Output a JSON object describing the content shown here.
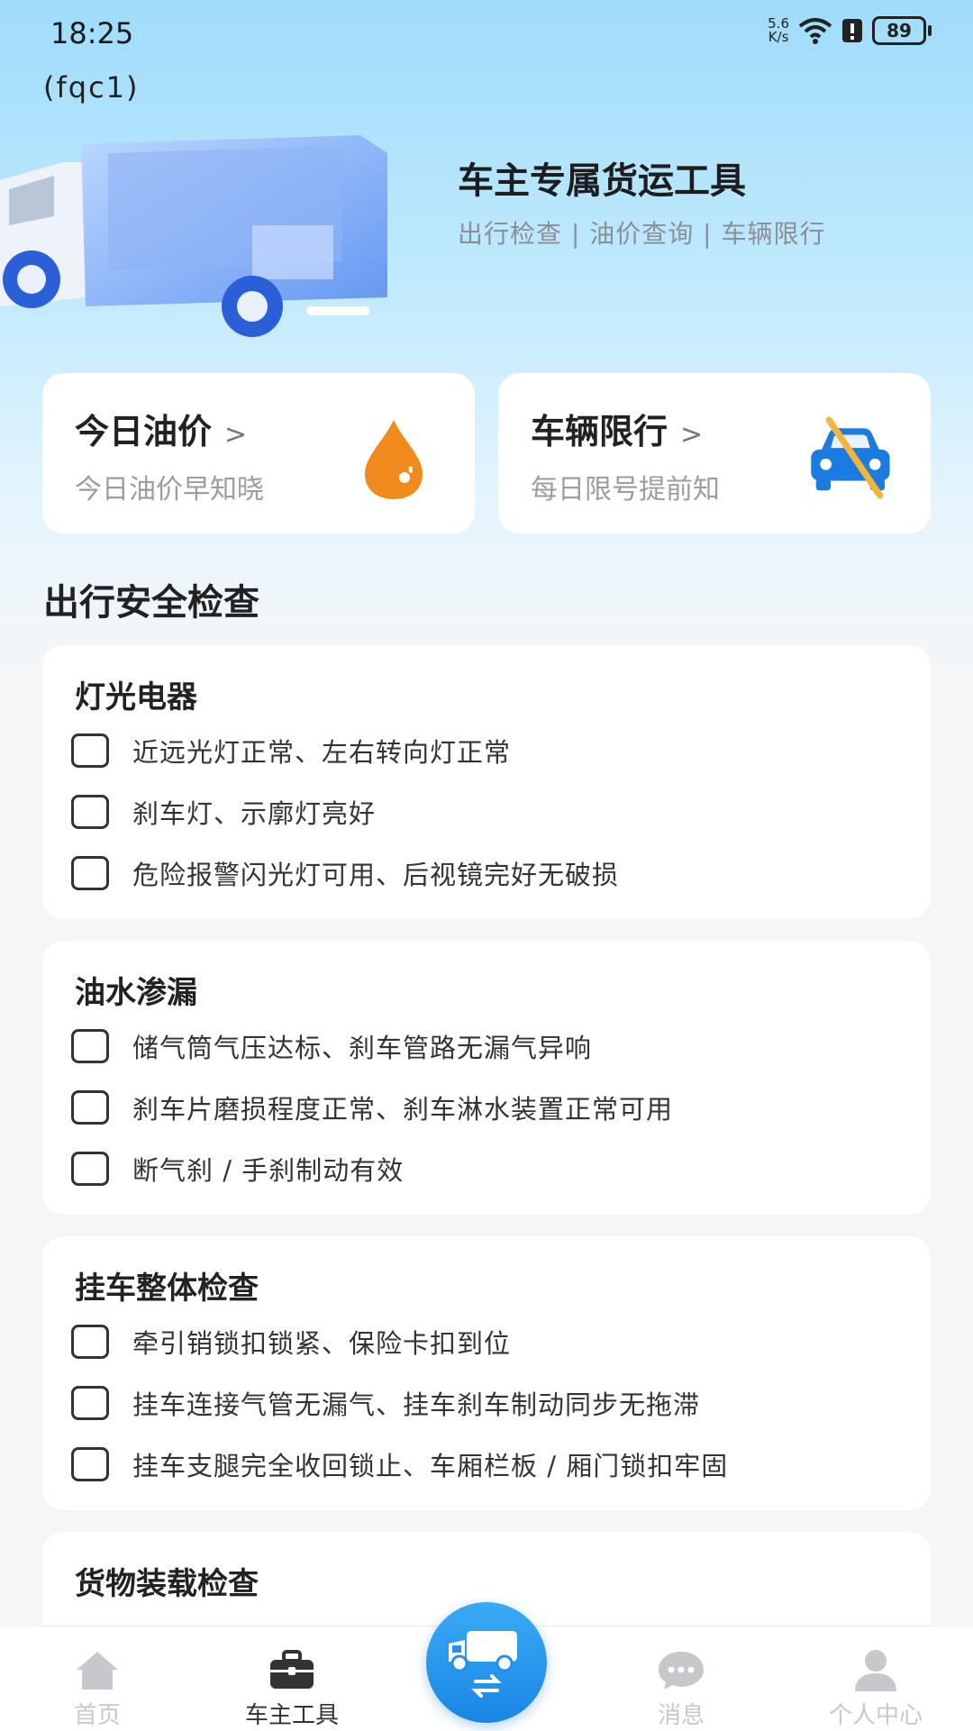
{
  "status_bar": {
    "time": "18:25",
    "speed_value": "5.6",
    "speed_unit": "K/s",
    "battery": "89"
  },
  "app_label": "(fqc1)",
  "hero": {
    "title": "车主专属货运工具",
    "subtitle": "出行检查 | 油价查询 | 车辆限行"
  },
  "tools": [
    {
      "title": "今日油价",
      "chevron": ">",
      "subtitle": "今日油价早知晓",
      "icon": "oil-drop-icon",
      "icon_color": "#f08a1c"
    },
    {
      "title": "车辆限行",
      "chevron": ">",
      "subtitle": "每日限号提前知",
      "icon": "no-car-icon",
      "icon_color": "#1a7be0"
    }
  ],
  "section_title": "出行安全检查",
  "groups": [
    {
      "title": "灯光电器",
      "items": [
        "近远光灯正常、左右转向灯正常",
        "刹车灯、示廓灯亮好",
        "危险报警闪光灯可用、后视镜完好无破损"
      ]
    },
    {
      "title": "油水渗漏",
      "items": [
        "储气筒气压达标、刹车管路无漏气异响",
        "刹车片磨损程度正常、刹车淋水装置正常可用",
        "断气刹 / 手刹制动有效"
      ]
    },
    {
      "title": "挂车整体检查",
      "items": [
        "牵引销锁扣锁紧、保险卡扣到位",
        "挂车连接气管无漏气、挂车刹车制动同步无拖滞",
        "挂车支腿完全收回锁止、车厢栏板 / 厢门锁扣牢固"
      ]
    },
    {
      "title": "货物装载检查",
      "items": []
    }
  ],
  "tab_bar": {
    "tabs": [
      {
        "label": "首页",
        "icon": "home-icon"
      },
      {
        "label": "车主工具",
        "icon": "briefcase-icon",
        "active": true
      },
      {
        "label": "消息",
        "icon": "message-icon"
      },
      {
        "label": "个人中心",
        "icon": "user-icon"
      }
    ],
    "center_icon": "truck-swap-icon",
    "active_color": "#333333",
    "inactive_color": "#c6c8cc"
  }
}
